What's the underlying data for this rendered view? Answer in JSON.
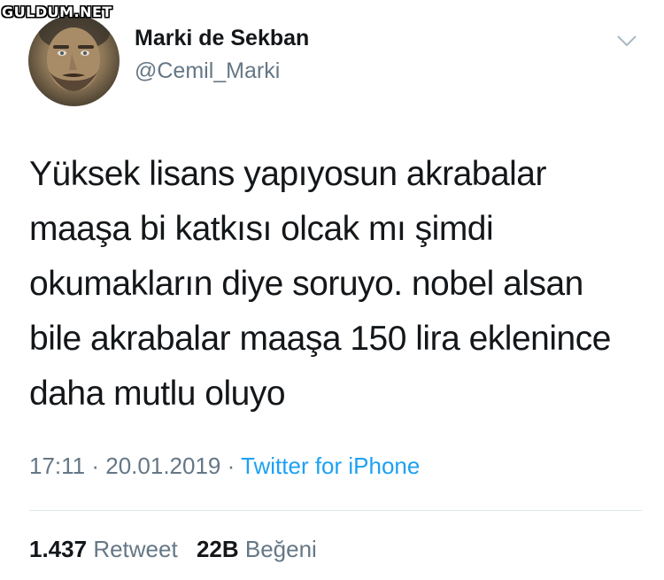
{
  "watermark": "GULDUM.NET",
  "author": {
    "display_name": "Marki de Sekban",
    "handle": "@Cemil_Marki"
  },
  "menu_icon": "chevron-down-icon",
  "tweet": {
    "lines": [
      "Yüksek lisans yapıyosun akrabalar",
      "maaşa bi katkısı olcak mı şimdi",
      "okumakların diye soruyo. nobel alsan",
      "bile akrabalar maaşa 150 lira eklenince",
      "daha mutlu oluyo"
    ]
  },
  "meta": {
    "time": "17:11",
    "separator": " · ",
    "date": "20.01.2019",
    "source": "Twitter for iPhone"
  },
  "stats": {
    "retweets_count": "1.437",
    "retweets_label": "Retweet",
    "likes_count": "22B",
    "likes_label": "Beğeni"
  },
  "colors": {
    "text": "#14171a",
    "secondary": "#657786",
    "link": "#1da1f2",
    "divider": "#e1e8ed"
  }
}
